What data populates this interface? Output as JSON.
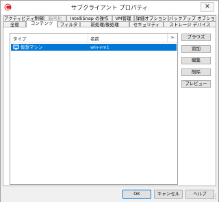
{
  "window": {
    "title": "サブクライアント プロパティ",
    "close_glyph": "✕"
  },
  "tabs": {
    "row1": [
      {
        "label": "アクティビティ制御",
        "enabled": true
      },
      {
        "label": "暗号化",
        "enabled": false
      },
      {
        "label": "IntelliSnap の操作",
        "enabled": true
      },
      {
        "label": "VM管理",
        "enabled": true
      },
      {
        "label": "詳細オプション",
        "enabled": true
      },
      {
        "label": "バックアップ オプション",
        "enabled": true
      }
    ],
    "row2": [
      {
        "label": "全般",
        "enabled": true
      },
      {
        "label": "コンテンツ",
        "enabled": true,
        "selected": true
      },
      {
        "label": "フィルタ",
        "enabled": true
      },
      {
        "label": "前処理/後処理",
        "enabled": true
      },
      {
        "label": "セキュリティ",
        "enabled": true
      },
      {
        "label": "ストレージ デバイス",
        "enabled": true
      }
    ]
  },
  "content_list": {
    "columns": [
      "タイプ",
      "名前"
    ],
    "column_chooser_glyph": "»",
    "rows": [
      {
        "type": "仮想マシン",
        "name": "win-vm1",
        "selected": true,
        "icon": "virtual-machine-icon"
      }
    ]
  },
  "side_buttons": [
    "ブラウズ",
    "追加",
    "編集",
    "削除",
    "プレビュー"
  ],
  "footer_buttons": {
    "ok": "OK",
    "cancel": "キャンセル",
    "help": "ヘルプ"
  },
  "colors": {
    "selection": "#0078d7",
    "disabled_text": "#8c8c8c",
    "dialog_bg": "#f0f0f0"
  }
}
